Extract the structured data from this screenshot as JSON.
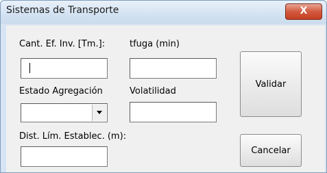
{
  "window": {
    "title": "Sistemas de Transporte",
    "close_glyph": "X"
  },
  "fields": {
    "cant_label": "Cant. Ef. Inv. [Tm.]:",
    "cant_value": "",
    "tfuga_label": "tfuga (min)",
    "tfuga_value": "",
    "estado_label": "Estado Agregación",
    "estado_value": "",
    "volatilidad_label": "Volatilidad",
    "volatilidad_value": "",
    "dist_label": "Dist. Lím. Establec. (m):",
    "dist_value": ""
  },
  "buttons": {
    "validar": "Validar",
    "cancelar": "Cancelar"
  }
}
